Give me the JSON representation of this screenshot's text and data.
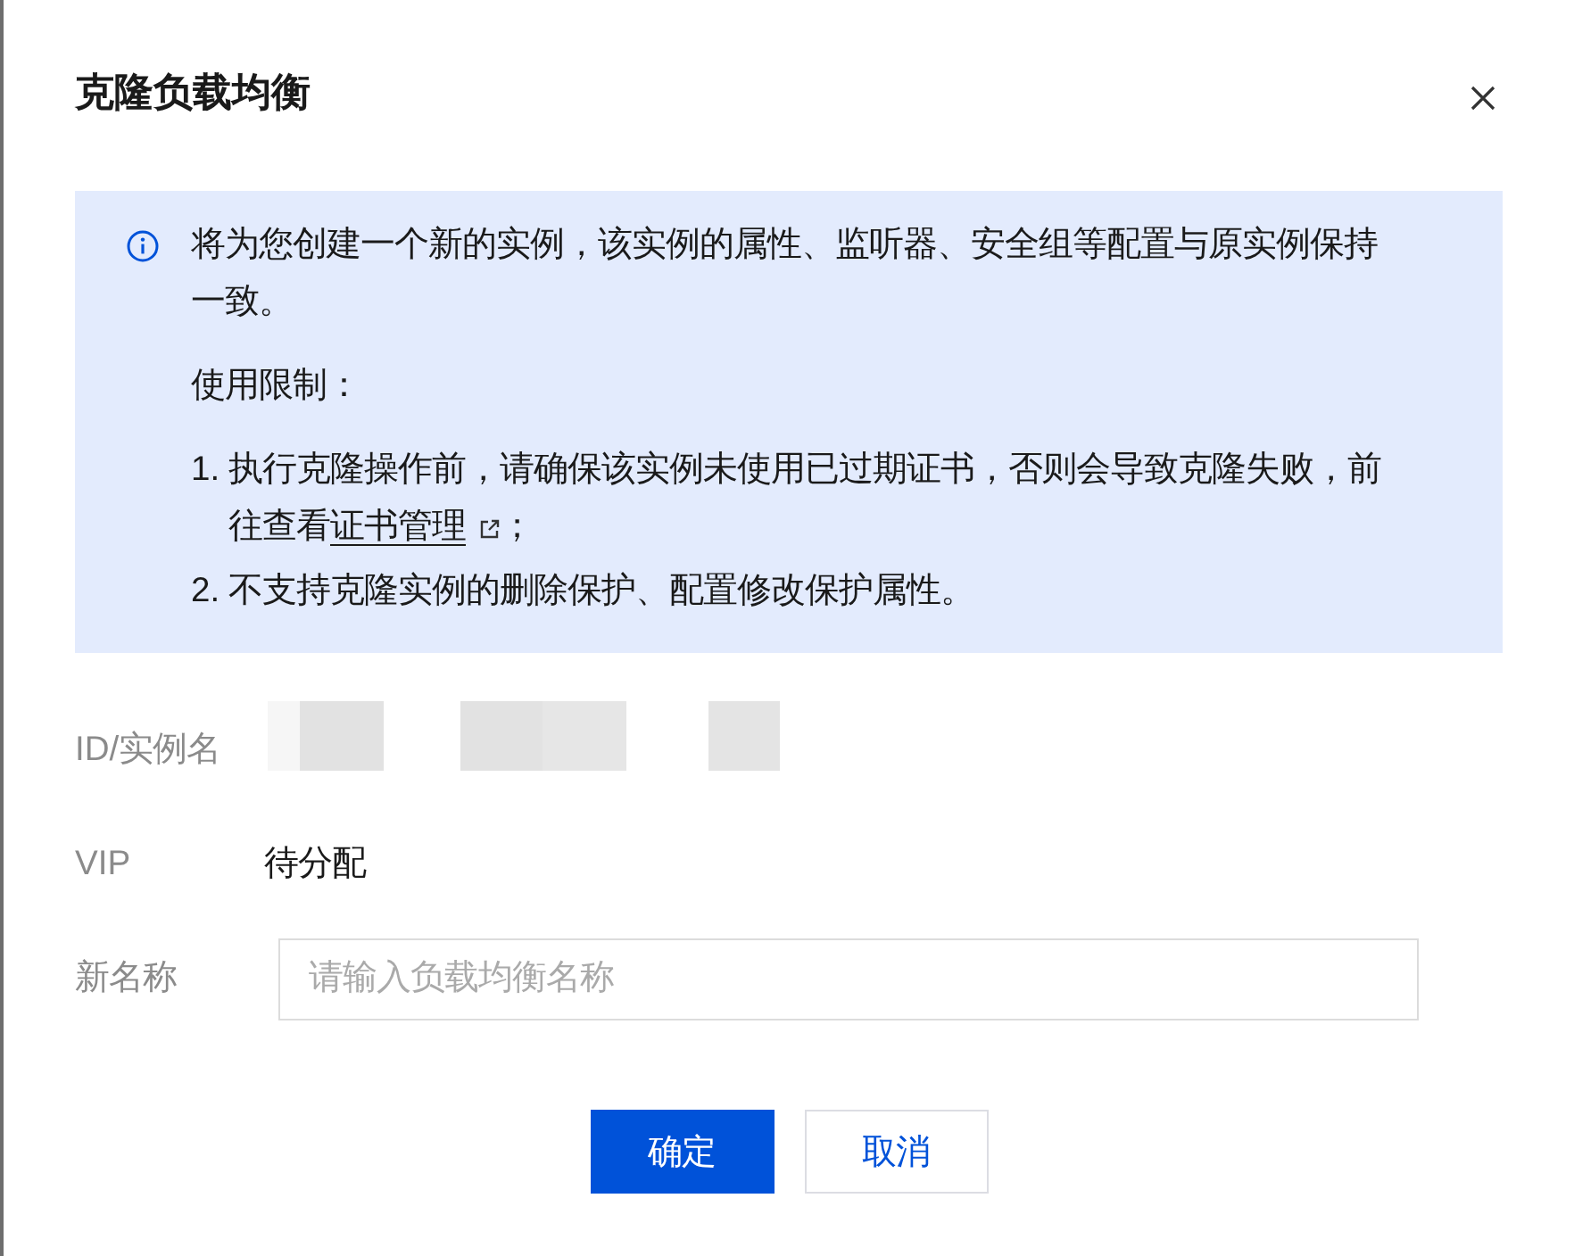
{
  "dialog": {
    "title": "克隆负载均衡"
  },
  "notice": {
    "paragraphs": [
      "将为您创建一个新的实例，该实例的属性、监听器、安全组等配置与原实例保持一致。",
      "使用限制："
    ],
    "items": [
      {
        "number": "1.",
        "text": "执行克隆操作前，请确保该实例未使用已过期证书，否则会导致克隆失败，前往查看",
        "link": "证书管理",
        "after": "；"
      },
      {
        "number": "2.",
        "text": "不支持克隆实例的删除保护、配置修改保护属性。"
      }
    ]
  },
  "fields": [
    {
      "label": "ID/实例名",
      "kind": "redacted"
    },
    {
      "label": "VIP",
      "kind": "text",
      "value": "待分配"
    },
    {
      "label": "新名称",
      "kind": "input",
      "placeholder": "请输入负载均衡名称"
    }
  ],
  "buttons": [
    {
      "label": "确定",
      "kind": "primary"
    },
    {
      "label": "取消",
      "kind": "secondary"
    }
  ]
}
